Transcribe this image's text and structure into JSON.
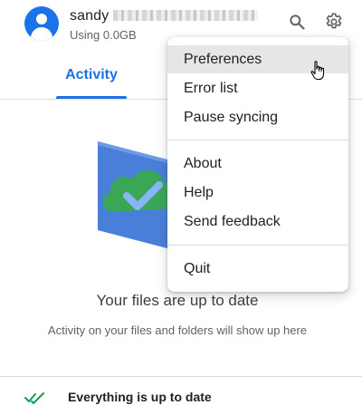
{
  "account": {
    "name": "sandy",
    "storage": "Using 0.0GB"
  },
  "toolbar": {
    "search_icon": "search-icon",
    "settings_icon": "gear-icon"
  },
  "tabs": [
    {
      "label": "Activity",
      "active": true
    }
  ],
  "status": {
    "title": "Your files are up to date",
    "subtitle": "Activity on your files and folders will show up here"
  },
  "footer": {
    "text": "Everything is up to date",
    "icon": "double-check-icon"
  },
  "menu": {
    "groups": [
      [
        "Preferences",
        "Error list",
        "Pause syncing"
      ],
      [
        "About",
        "Help",
        "Send feedback"
      ],
      [
        "Quit"
      ]
    ],
    "hovered": "Preferences"
  },
  "colors": {
    "accent": "#1a73e8",
    "folder_blue": "#4a7fd9",
    "cloud_green": "#3aa757",
    "check_green": "#0f9d58"
  }
}
